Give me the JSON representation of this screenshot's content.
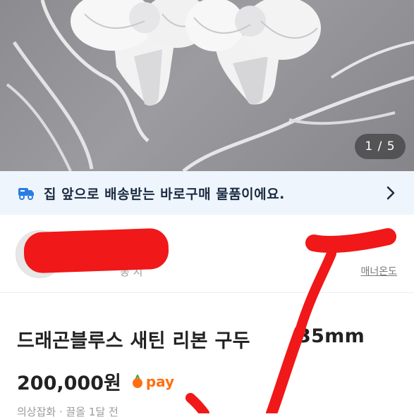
{
  "photo": {
    "counter": "1 / 5"
  },
  "banner": {
    "text": "집 앞으로 배송받는 바로구매 물품이에요."
  },
  "seller": {
    "location_partial": "동 지",
    "manner_label": "매너온도"
  },
  "product": {
    "title": "드래곤블루스 새틴 리본 구두",
    "title_size": "35mm",
    "price": "200,000원",
    "pay_label": "pay"
  },
  "footer": {
    "partial_text": "의상잡화 · 끌올 1달 전"
  },
  "colors": {
    "pay_orange": "#ff6f0f",
    "pen_red": "#f01818",
    "banner_bg": "#eef5fd",
    "truck_blue": "#2a7de1"
  },
  "icons": [
    "truck-icon",
    "chevron-right-icon",
    "carrot-icon"
  ]
}
